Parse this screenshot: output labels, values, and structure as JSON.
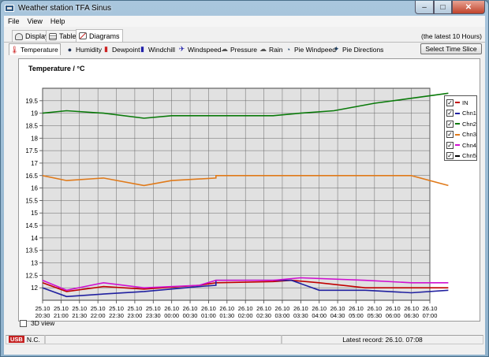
{
  "window": {
    "title": "Weather station TFA Sinus",
    "close_glyph": "✕",
    "max_glyph": "□",
    "min_glyph": "–"
  },
  "menu": [
    "File",
    "View",
    "Help"
  ],
  "view_tabs": [
    {
      "label": "Display"
    },
    {
      "label": "Table"
    },
    {
      "label": "Diagrams"
    }
  ],
  "period_label": "(the latest 10 Hours)",
  "diagram_tabs": [
    {
      "label": "Temperature",
      "icon": "thermometer-icon",
      "glyph": "🌡"
    },
    {
      "label": "Humidity",
      "icon": "humidity-icon",
      "glyph": "💧"
    },
    {
      "label": "Dewpoint",
      "icon": "dewpoint-icon",
      "glyph": "🌡"
    },
    {
      "label": "Windchill",
      "icon": "windchill-icon",
      "glyph": "🌡"
    },
    {
      "label": "Windspeed",
      "icon": "windspeed-icon",
      "glyph": "✈"
    },
    {
      "label": "Pressure",
      "icon": "pressure-icon",
      "glyph": "☁"
    },
    {
      "label": "Rain",
      "icon": "rain-icon",
      "glyph": "☁"
    },
    {
      "label": "Pie Windpeed",
      "icon": "pie-windspeed-icon",
      "glyph": "◔"
    },
    {
      "label": "Pie Directions",
      "icon": "pie-directions-icon",
      "glyph": "✦"
    }
  ],
  "select_button": "Select Time Slice",
  "three_d_label": "3D view",
  "status": {
    "usb": "USB",
    "connection": "N.C.",
    "latest_record": "Latest record: 26.10. 07:08"
  },
  "chart_data": {
    "type": "line",
    "title": "Temperature / °C",
    "ylim": [
      11.5,
      20
    ],
    "yticks": [
      12,
      12.5,
      13,
      13.5,
      14,
      14.5,
      15,
      15.5,
      16,
      16.5,
      17,
      17.5,
      18,
      18.5,
      19,
      19.5
    ],
    "ytick_labels": [
      "12",
      "12.5",
      "13",
      "13.5",
      "14",
      "14.5",
      "15",
      "15.5",
      "16",
      "16.5",
      "17",
      "17.5",
      "18",
      "18.5",
      "19",
      "19.5"
    ],
    "categories": [
      [
        "25.10",
        "20:30"
      ],
      [
        "25.10",
        "21:00"
      ],
      [
        "25.10",
        "21:30"
      ],
      [
        "25.10",
        "22:00"
      ],
      [
        "25.10",
        "22:30"
      ],
      [
        "25.10",
        "23:00"
      ],
      [
        "25.10",
        "23:30"
      ],
      [
        "26.10",
        "00:00"
      ],
      [
        "26.10",
        "00:30"
      ],
      [
        "26.10",
        "01:00"
      ],
      [
        "26.10",
        "01:30"
      ],
      [
        "26.10",
        "02:00"
      ],
      [
        "26.10",
        "02:30"
      ],
      [
        "26.10",
        "03:00"
      ],
      [
        "26.10",
        "03:30"
      ],
      [
        "26.10",
        "04:00"
      ],
      [
        "26.10",
        "04:30"
      ],
      [
        "26.10",
        "05:00"
      ],
      [
        "26.10",
        "05:30"
      ],
      [
        "26.10",
        "06:00"
      ],
      [
        "26.10",
        "06:30"
      ],
      [
        "26.10",
        "07:00"
      ]
    ],
    "grid": true,
    "legend_position": "right",
    "series": [
      {
        "name": "IN",
        "color": "#c00000",
        "checked": true,
        "points": [
          [
            0,
            12.2
          ],
          [
            1.3,
            11.85
          ],
          [
            3.3,
            12.05
          ],
          [
            5.5,
            11.95
          ],
          [
            8.5,
            12.1
          ],
          [
            9.4,
            12.2
          ],
          [
            12.5,
            12.25
          ],
          [
            13.5,
            12.3
          ],
          [
            15,
            12.2
          ],
          [
            17.5,
            12.0
          ],
          [
            22,
            12.0
          ]
        ]
      },
      {
        "name": "Chn1",
        "color": "#2020a0",
        "checked": true,
        "points": [
          [
            0,
            12.0
          ],
          [
            1.3,
            11.65
          ],
          [
            3.3,
            11.75
          ],
          [
            5.5,
            11.85
          ],
          [
            8.5,
            12.05
          ],
          [
            9.4,
            12.1
          ],
          [
            9.4,
            12.3
          ],
          [
            13.5,
            12.3
          ],
          [
            15,
            11.9
          ],
          [
            17.5,
            11.9
          ],
          [
            20,
            11.8
          ],
          [
            22,
            11.9
          ]
        ]
      },
      {
        "name": "Chn2",
        "color": "#0a7a0a",
        "checked": true,
        "points": [
          [
            0,
            19.0
          ],
          [
            1.3,
            19.1
          ],
          [
            3.3,
            19.0
          ],
          [
            5.5,
            18.8
          ],
          [
            7,
            18.9
          ],
          [
            12.5,
            18.9
          ],
          [
            14,
            19.0
          ],
          [
            15.8,
            19.1
          ],
          [
            18,
            19.4
          ],
          [
            20,
            19.6
          ],
          [
            22,
            19.8
          ]
        ]
      },
      {
        "name": "Chn3",
        "color": "#e07a1a",
        "checked": true,
        "points": [
          [
            0,
            16.5
          ],
          [
            1.3,
            16.3
          ],
          [
            3.3,
            16.4
          ],
          [
            5.5,
            16.1
          ],
          [
            7,
            16.3
          ],
          [
            9.4,
            16.4
          ],
          [
            9.4,
            16.5
          ],
          [
            20,
            16.5
          ],
          [
            22,
            16.1
          ]
        ]
      },
      {
        "name": "Chn4",
        "color": "#d010d0",
        "checked": true,
        "points": [
          [
            0,
            12.3
          ],
          [
            1.3,
            11.9
          ],
          [
            3.3,
            12.2
          ],
          [
            5.5,
            12.0
          ],
          [
            8.5,
            12.1
          ],
          [
            9.4,
            12.3
          ],
          [
            12.5,
            12.3
          ],
          [
            14,
            12.4
          ],
          [
            17.5,
            12.3
          ],
          [
            20,
            12.2
          ],
          [
            22,
            12.2
          ]
        ]
      },
      {
        "name": "Chn5",
        "color": "#000000",
        "checked": true,
        "points": []
      }
    ]
  }
}
